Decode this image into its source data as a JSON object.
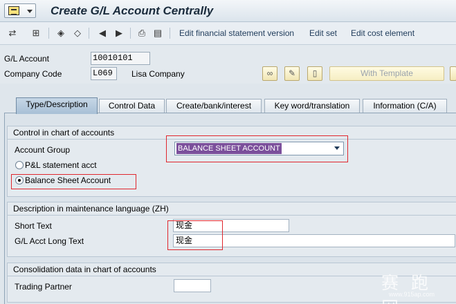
{
  "window": {
    "title": "Create G/L Account Centrally"
  },
  "toolbar": {
    "icons": [
      "display-change-icon",
      "other-account-icon",
      "previous-entry-icon",
      "next-entry-icon",
      "first-icon",
      "back-icon",
      "forward-icon",
      "print-icon",
      "document-icon"
    ],
    "links": [
      "Edit financial statement version",
      "Edit set",
      "Edit cost element"
    ]
  },
  "header": {
    "gl_account_label": "G/L Account",
    "gl_account_value": "10010101",
    "company_code_label": "Company Code",
    "company_code_value": "L069",
    "company_name": "Lisa Company",
    "with_template_label": "With Template"
  },
  "tabs": [
    "Type/Description",
    "Control Data",
    "Create/bank/interest",
    "Key word/translation",
    "Information (C/A)"
  ],
  "active_tab": "Type/Description",
  "control_group": {
    "title": "Control in chart of accounts",
    "account_group_label": "Account Group",
    "account_group_value": "BALANCE SHEET ACCOUNT",
    "radio_pl": "P&L statement acct",
    "radio_bs": "Balance Sheet Account",
    "selected": "Balance Sheet Account"
  },
  "description_group": {
    "title": "Description in maintenance language (ZH)",
    "short_text_label": "Short Text",
    "short_text_value": "现金",
    "long_text_label": "G/L Acct Long Text",
    "long_text_value": "现金"
  },
  "consolidation_group": {
    "title": "Consolidation data in chart of accounts",
    "trading_partner_label": "Trading Partner",
    "trading_partner_value": ""
  },
  "watermark": {
    "text": "赛 跑 网",
    "url": "www.915ap.com"
  },
  "colors": {
    "highlight_red": "#e0262d",
    "selection_purple": "#7b4f9b",
    "title_text": "#1a2b3c"
  }
}
